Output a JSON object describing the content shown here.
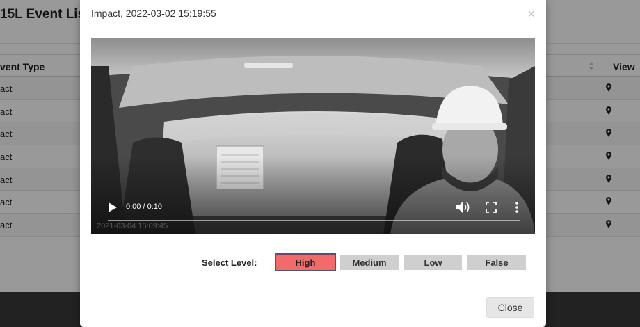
{
  "background": {
    "page_title": "15L Event Lis",
    "table": {
      "headers": {
        "event_type": "vent Type",
        "view": "View"
      },
      "rows": [
        {
          "event_type": "act"
        },
        {
          "event_type": "act"
        },
        {
          "event_type": "act"
        },
        {
          "event_type": "act"
        },
        {
          "event_type": "act"
        },
        {
          "event_type": "act"
        },
        {
          "event_type": "act"
        }
      ]
    }
  },
  "modal": {
    "title": "Impact, 2022-03-02 15:19:55",
    "close_symbol": "×",
    "video": {
      "time": "0:00 / 0:10",
      "progress": 0,
      "watermark": "2021-03-04 15:09:45"
    },
    "level": {
      "label": "Select Level:",
      "options": [
        "High",
        "Medium",
        "Low",
        "False"
      ],
      "selected": "High"
    },
    "footer": {
      "close_label": "Close"
    }
  },
  "colors": {
    "selected_level": "#f26b6b",
    "selected_border": "#3d5a85",
    "level_button": "#cfcfcf"
  },
  "icons": {
    "play": "play-icon",
    "volume": "volume-icon",
    "fullscreen": "fullscreen-icon",
    "more": "more-vertical-icon",
    "sort": "sort-icon",
    "map_pin": "map-pin-icon",
    "close": "close-icon"
  }
}
